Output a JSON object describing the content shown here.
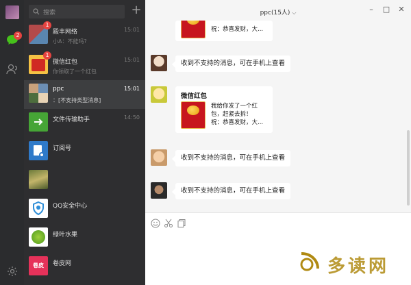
{
  "rail": {
    "chat_badge": "2"
  },
  "search": {
    "placeholder": "搜索"
  },
  "conversations": [
    {
      "name": "殿丰网络",
      "time": "15:01",
      "preview": "小A：不能吗?",
      "badge": "1",
      "active": false
    },
    {
      "name": "微信红包",
      "time": "15:01",
      "preview": "你领取了一个红包",
      "badge": "1",
      "active": false
    },
    {
      "name": "ppc",
      "time": "15:01",
      "preview": "：[不支持类型消息]",
      "badge": "",
      "active": true
    },
    {
      "name": "文件传输助手",
      "time": "14:50",
      "preview": "",
      "badge": "",
      "active": false
    },
    {
      "name": "订阅号",
      "time": "",
      "preview": "",
      "badge": "",
      "active": false
    },
    {
      "name": "",
      "time": "",
      "preview": "",
      "badge": "",
      "active": false
    },
    {
      "name": "QQ安全中心",
      "time": "",
      "preview": "",
      "badge": "",
      "active": false
    },
    {
      "name": "绿叶水果",
      "time": "",
      "preview": "",
      "badge": "",
      "active": false
    },
    {
      "name": "卷皮网",
      "time": "",
      "preview": "",
      "badge": "",
      "active": false
    }
  ],
  "chat": {
    "title": "ppc(15人)",
    "messages": [
      {
        "type": "redpacket_partial",
        "line2": "祝：恭喜发财，大..."
      },
      {
        "type": "text",
        "text": "收到不支持的消息，可在手机上查看"
      },
      {
        "type": "redpacket",
        "title": "微信红包",
        "line1": "我给你发了一个红",
        "line1b": "包，赶紧去拆！",
        "line2": "祝：恭喜发财，大..."
      },
      {
        "type": "text",
        "text": "收到不支持的消息，可在手机上查看"
      },
      {
        "type": "text",
        "text": "收到不支持的消息，可在手机上查看"
      }
    ]
  },
  "avatar_labels": {
    "wenjian": "",
    "juanpi": "卷皮"
  },
  "watermark": {
    "text": "多读网"
  },
  "colors": {
    "badge": "#e64340",
    "rail_bg": "#2b2c2e",
    "list_bg": "#2e2e30",
    "wechat_green": "#46c11b"
  }
}
